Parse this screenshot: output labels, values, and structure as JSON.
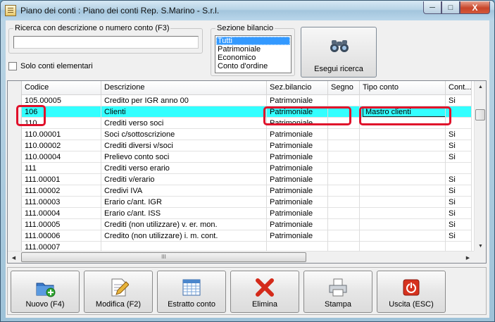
{
  "window": {
    "title": "Piano dei conti : Piano dei conti Rep. S.Marino - S.r.l.",
    "minimize_glyph": "─",
    "maximize_glyph": "□",
    "close_glyph": "X"
  },
  "search": {
    "legend": "Ricerca con descrizione o numero conto (F3)",
    "value": "",
    "only_elementary_label": "Solo conti elementari"
  },
  "sezione": {
    "legend": "Sezione bilancio",
    "options": [
      "Tutti",
      "Patrimoniale",
      "Economico",
      "Conto d'ordine"
    ],
    "selected": "Tutti"
  },
  "search_button": {
    "label": "Esegui ricerca",
    "icon": "binoculars-icon"
  },
  "grid": {
    "columns": [
      "Codice",
      "Descrizione",
      "Sez.bilancio",
      "Segno",
      "Tipo conto",
      "Cont..."
    ],
    "rows": [
      [
        "105.00005",
        "Credito per IGR anno 00",
        "Patrimoniale",
        "",
        "",
        "Si"
      ],
      [
        "106",
        "Clienti",
        "Patrimoniale",
        "",
        "Mastro clienti",
        ""
      ],
      [
        "110",
        "Crediti verso soci",
        "Patrimoniale",
        "",
        "",
        ""
      ],
      [
        "110.00001",
        "Soci c/sottoscrizione",
        "Patrimoniale",
        "",
        "",
        "Si"
      ],
      [
        "110.00002",
        "Crediti diversi v/soci",
        "Patrimoniale",
        "",
        "",
        "Si"
      ],
      [
        "110.00004",
        "Prelievo conto soci",
        "Patrimoniale",
        "",
        "",
        "Si"
      ],
      [
        "111",
        "Crediti verso erario",
        "Patrimoniale",
        "",
        "",
        ""
      ],
      [
        "111.00001",
        "Crediti v/erario",
        "Patrimoniale",
        "",
        "",
        "Si"
      ],
      [
        "111.00002",
        "Credivi IVA",
        "Patrimoniale",
        "",
        "",
        "Si"
      ],
      [
        "111.00003",
        "Erario c/ant. IGR",
        "Patrimoniale",
        "",
        "",
        "Si"
      ],
      [
        "111.00004",
        "Erario c/ant. ISS",
        "Patrimoniale",
        "",
        "",
        "Si"
      ],
      [
        "111.00005",
        "Crediti (non utilizzare) v. er. mon.",
        "Patrimoniale",
        "",
        "",
        "Si"
      ],
      [
        "111.00006",
        "Credito (non utilizzare) i. m. cont.",
        "Patrimoniale",
        "",
        "",
        "Si"
      ],
      [
        "111.00007",
        "",
        "",
        "",
        "",
        ""
      ]
    ],
    "selected_index": 1,
    "scroll_grip": "III"
  },
  "toolbar": {
    "buttons": [
      {
        "label": "Nuovo (F4)",
        "icon": "new-folder-icon"
      },
      {
        "label": "Modifica (F2)",
        "icon": "edit-document-icon"
      },
      {
        "label": "Estratto conto",
        "icon": "calendar-sheet-icon"
      },
      {
        "label": "Elimina",
        "icon": "delete-x-icon"
      },
      {
        "label": "Stampa",
        "icon": "printer-icon"
      },
      {
        "label": "Uscita (ESC)",
        "icon": "power-exit-icon"
      }
    ]
  },
  "colors": {
    "selected_row": "#33ffff",
    "highlight": "#e0102a",
    "list_selection": "#3399ff"
  }
}
